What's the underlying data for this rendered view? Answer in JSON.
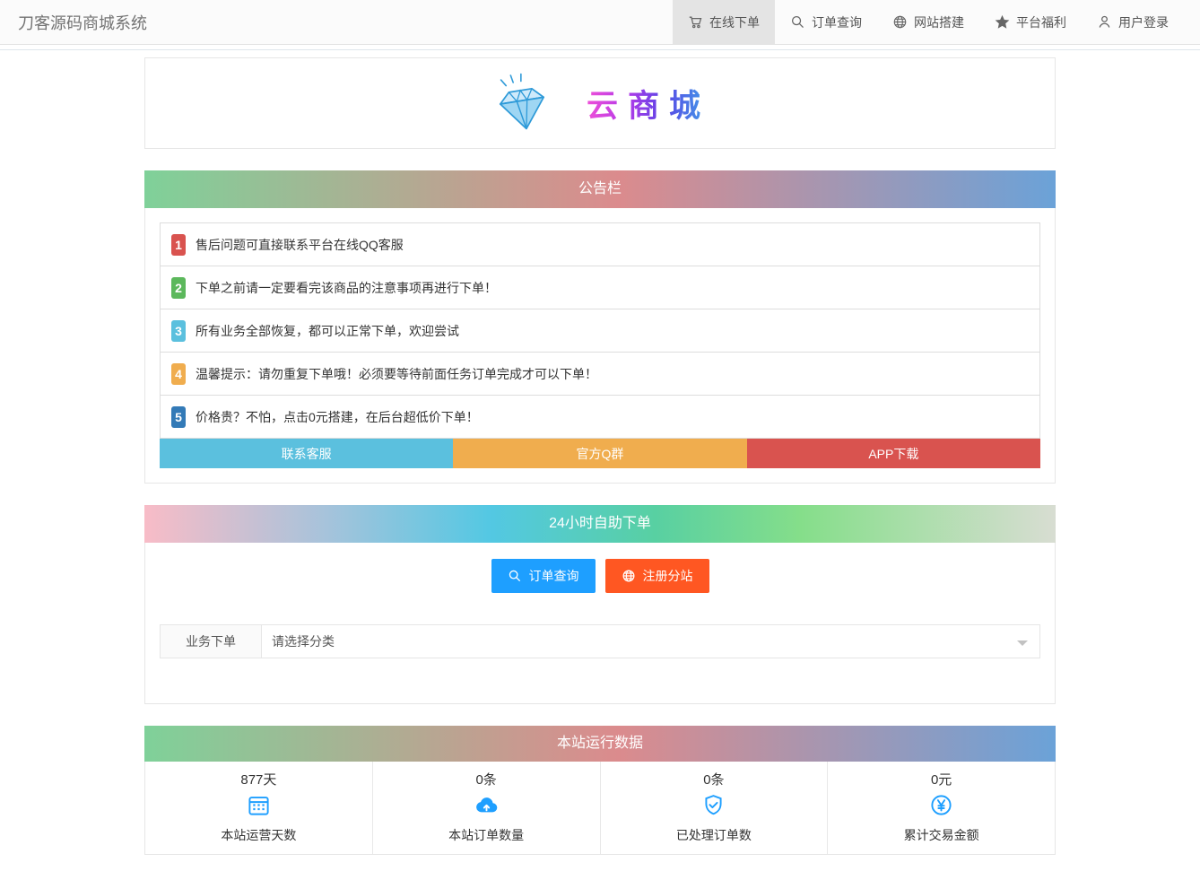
{
  "navbar": {
    "brand": "刀客源码商城系统",
    "items": [
      {
        "label": "在线下单",
        "icon": "cart-icon",
        "active": true
      },
      {
        "label": "订单查询",
        "icon": "search-icon",
        "active": false
      },
      {
        "label": "网站搭建",
        "icon": "globe-icon",
        "active": false
      },
      {
        "label": "平台福利",
        "icon": "star-icon",
        "active": false
      },
      {
        "label": "用户登录",
        "icon": "user-icon",
        "active": false
      }
    ]
  },
  "logo": {
    "text": "云商城",
    "icon": "diamond-icon"
  },
  "announcement": {
    "title": "公告栏",
    "items": [
      {
        "num": "1",
        "color": "#d9534f",
        "text": "售后问题可直接联系平台在线QQ客服"
      },
      {
        "num": "2",
        "color": "#5cb85c",
        "text": "下单之前请一定要看完该商品的注意事项再进行下单！"
      },
      {
        "num": "3",
        "color": "#5bc0de",
        "text": "所有业务全部恢复，都可以正常下单，欢迎尝试"
      },
      {
        "num": "4",
        "color": "#f0ad4e",
        "text": "温馨提示：请勿重复下单哦！必须要等待前面任务订单完成才可以下单！"
      },
      {
        "num": "5",
        "color": "#337ab7",
        "text": "价格贵？不怕，点击0元搭建，在后台超低价下单！"
      }
    ],
    "buttons": [
      {
        "label": "联系客服",
        "color": "#5bc0de"
      },
      {
        "label": "官方Q群",
        "color": "#f0ad4e"
      },
      {
        "label": "APP下载",
        "color": "#d9534f"
      }
    ]
  },
  "self_order": {
    "title": "24小时自助下单",
    "actions": [
      {
        "label": "订单查询",
        "color": "#1E9FFF",
        "icon": "search-icon"
      },
      {
        "label": "注册分站",
        "color": "#FF5722",
        "icon": "globe-icon"
      }
    ],
    "form": {
      "label": "业务下单",
      "select_value": "请选择分类"
    }
  },
  "stats": {
    "title": "本站运行数据",
    "icon_color": "#1e9fff",
    "items": [
      {
        "value": "877天",
        "label": "本站运营天数",
        "icon": "calendar-icon"
      },
      {
        "value": "0条",
        "label": "本站订单数量",
        "icon": "cloud-upload-icon"
      },
      {
        "value": "0条",
        "label": "已处理订单数",
        "icon": "shield-check-icon"
      },
      {
        "value": "0元",
        "label": "累计交易金额",
        "icon": "yen-circle-icon"
      }
    ]
  }
}
